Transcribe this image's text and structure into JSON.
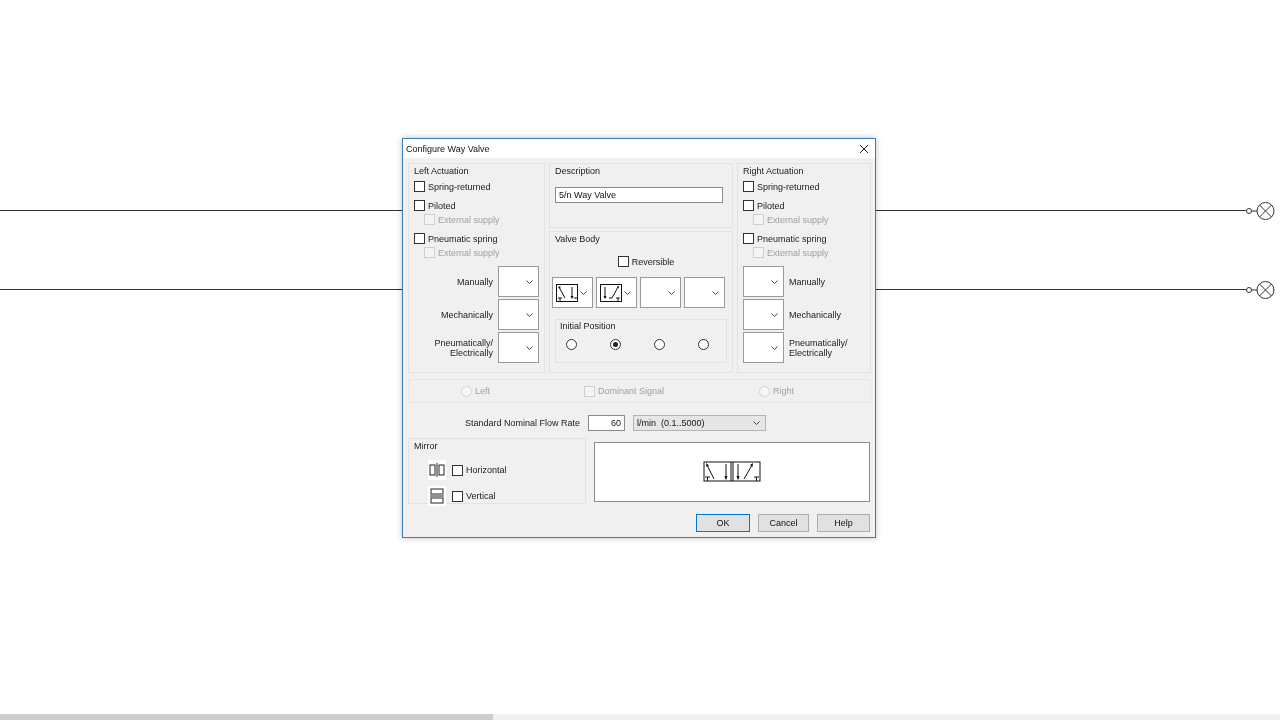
{
  "window": {
    "title": "Configure Way Valve"
  },
  "left_actuation": {
    "title": "Left Actuation",
    "options": [
      {
        "label": "Spring-returned",
        "checked": false,
        "disabled": false
      },
      {
        "label": "Piloted",
        "checked": false,
        "disabled": false,
        "children": [
          {
            "label": "External supply",
            "checked": false,
            "disabled": true
          }
        ]
      },
      {
        "label": "Pneumatic spring",
        "checked": false,
        "disabled": false,
        "children": [
          {
            "label": "External supply",
            "checked": false,
            "disabled": true
          }
        ]
      }
    ],
    "dropdowns": [
      {
        "label": "Manually"
      },
      {
        "label": "Mechanically"
      },
      {
        "label": "Pneumatically/ Electrically"
      }
    ]
  },
  "description": {
    "title": "Description",
    "value": "5/n Way Valve"
  },
  "valve_body": {
    "title": "Valve Body",
    "reversible": {
      "label": "Reversible",
      "checked": false
    },
    "positions": [
      {
        "kind": "cross-down"
      },
      {
        "kind": "cross-up"
      },
      {
        "kind": "empty"
      },
      {
        "kind": "empty"
      }
    ],
    "initial_position": {
      "title": "Initial Position",
      "options": [
        {
          "selected": false
        },
        {
          "selected": true
        },
        {
          "selected": false
        },
        {
          "selected": false
        }
      ]
    }
  },
  "right_actuation": {
    "title": "Right Actuation",
    "options": [
      {
        "label": "Spring-returned",
        "checked": false,
        "disabled": false
      },
      {
        "label": "Piloted",
        "checked": false,
        "disabled": false,
        "children": [
          {
            "label": "External supply",
            "checked": false,
            "disabled": true
          }
        ]
      },
      {
        "label": "Pneumatic spring",
        "checked": false,
        "disabled": false,
        "children": [
          {
            "label": "External supply",
            "checked": false,
            "disabled": true
          }
        ]
      }
    ],
    "dropdowns": [
      {
        "label": "Manually"
      },
      {
        "label": "Mechanically"
      },
      {
        "label": "Pneumatically/ Electrically"
      }
    ]
  },
  "signal": {
    "left": {
      "label": "Left",
      "selected": false,
      "disabled": true
    },
    "dominant": {
      "label": "Dominant Signal",
      "checked": false,
      "disabled": true
    },
    "right": {
      "label": "Right",
      "selected": false,
      "disabled": true
    }
  },
  "flow_rate": {
    "label": "Standard Nominal Flow Rate",
    "value": "60",
    "unit": "l/min  (0.1..5000)"
  },
  "mirror": {
    "title": "Mirror",
    "options": [
      {
        "kind": "horizontal",
        "label": "Horizontal",
        "checked": false
      },
      {
        "kind": "vertical",
        "label": "Vertical",
        "checked": false
      }
    ]
  },
  "buttons": [
    {
      "label": "OK",
      "default": true
    },
    {
      "label": "Cancel",
      "default": false
    },
    {
      "label": "Help",
      "default": false
    }
  ]
}
